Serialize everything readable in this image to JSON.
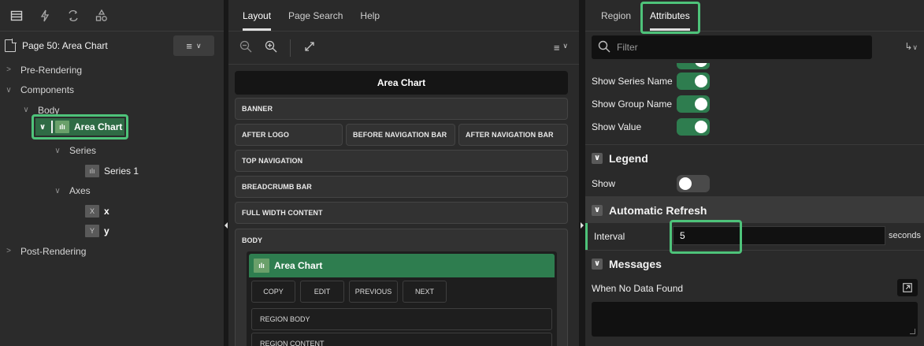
{
  "left": {
    "page_title": "Page 50: Area Chart",
    "menu_icon": "menu-lines-icon",
    "tree": [
      {
        "label": "Pre-Rendering",
        "level": 0,
        "expanded": false
      },
      {
        "label": "Components",
        "level": 0,
        "expanded": true
      },
      {
        "label": "Body",
        "level": 1,
        "expanded": true
      },
      {
        "label": "Area Chart",
        "level": 2,
        "expanded": true,
        "selected": true
      },
      {
        "label": "Series",
        "level": 3,
        "expanded": true
      },
      {
        "label": "Series 1",
        "level": 4
      },
      {
        "label": "Axes",
        "level": 3,
        "expanded": true
      },
      {
        "label": "x",
        "level": 4,
        "badge": "X"
      },
      {
        "label": "y",
        "level": 4,
        "badge": "Y"
      },
      {
        "label": "Post-Rendering",
        "level": 0,
        "expanded": false
      }
    ]
  },
  "middle": {
    "tabs": [
      "Layout",
      "Page Search",
      "Help"
    ],
    "active_tab": "Layout",
    "chart_title": "Area Chart",
    "slots": {
      "banner": "BANNER",
      "after_logo": "AFTER LOGO",
      "before_nav": "BEFORE NAVIGATION BAR",
      "after_nav": "AFTER NAVIGATION BAR",
      "top_nav": "TOP NAVIGATION",
      "breadcrumb": "BREADCRUMB BAR",
      "full_width": "FULL WIDTH CONTENT",
      "body": "BODY"
    },
    "region": {
      "title": "Area Chart",
      "buttons": [
        "COPY",
        "EDIT",
        "PREVIOUS",
        "NEXT"
      ],
      "region_body": "REGION BODY",
      "region_content": "REGION CONTENT"
    }
  },
  "right": {
    "tabs": [
      "Region",
      "Attributes"
    ],
    "active_tab": "Attributes",
    "filter_placeholder": "Filter",
    "toggles": [
      {
        "label": "Show Series Name",
        "on": true
      },
      {
        "label": "Show Group Name",
        "on": true
      },
      {
        "label": "Show Value",
        "on": true
      }
    ],
    "legend": {
      "title": "Legend",
      "show_label": "Show",
      "show_on": false
    },
    "auto_refresh": {
      "title": "Automatic Refresh",
      "interval_label": "Interval",
      "interval_value": "5",
      "unit": "seconds"
    },
    "messages": {
      "title": "Messages",
      "no_data_label": "When No Data Found"
    }
  },
  "colors": {
    "accent_green": "#2e7d4f",
    "highlight_green": "#4ec37a"
  }
}
